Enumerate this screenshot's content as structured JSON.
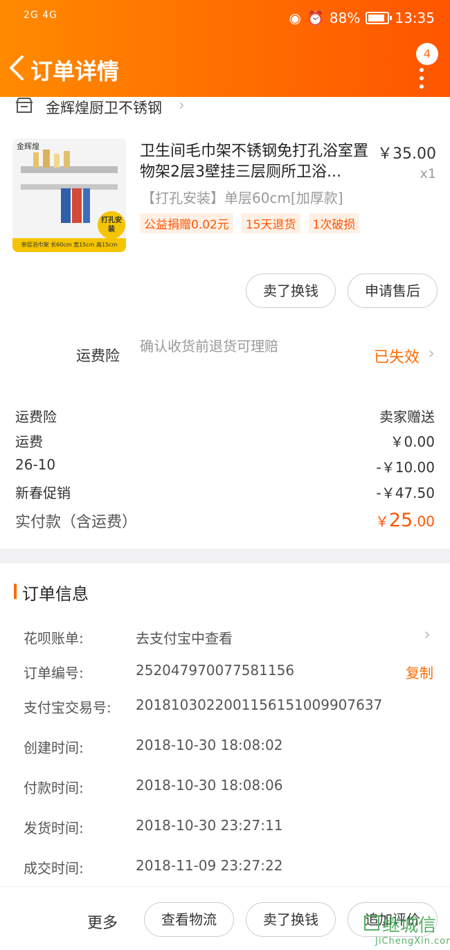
{
  "status_bar": {
    "signal": "2G 4G",
    "battery": "88%",
    "battery_level": 0.88,
    "time": "13:35"
  },
  "header": {
    "title": "订单详情",
    "badge_count": "4"
  },
  "shop": {
    "name": "金辉煌厨卫不锈钢"
  },
  "product": {
    "name": "卫生间毛巾架不锈钢免打孔浴室置物架2层3壁挂三层厕所卫浴...",
    "price": "￥35.00",
    "qty": "x1",
    "sku": "【打孔安装】单层60cm[加厚款]",
    "tags": [
      "公益捐赠0.02元",
      "15天退货",
      "1次破损"
    ],
    "image_brand": "金辉煌",
    "image_badge": "打孔安装",
    "image_caption": "单层浴巾架 长60cm 宽15cm 高15cm"
  },
  "actions": {
    "sell": "卖了换钱",
    "after_sale": "申请售后"
  },
  "insurance": {
    "label": "运费险",
    "desc": "确认收货前退货可理赔",
    "status": "已失效"
  },
  "fees": [
    {
      "label": "运费险",
      "value": "卖家赠送"
    },
    {
      "label": "运费",
      "value": "￥0.00"
    },
    {
      "label": "26-10",
      "value": "-￥10.00"
    },
    {
      "label": "新春促销",
      "value": "-￥47.50"
    }
  ],
  "total": {
    "label": "实付款（含运费）",
    "currency": "￥",
    "int": "25",
    "dec": ".00"
  },
  "order_info": {
    "title": "订单信息",
    "rows": [
      {
        "label": "花呗账单:",
        "value": "去支付宝中查看"
      },
      {
        "label": "订单编号:",
        "value": "252047970077581156",
        "action": "复制"
      },
      {
        "label": "支付宝交易号:",
        "value": "2018103022001156151009907637"
      },
      {
        "label": "创建时间:",
        "value": "2018-10-30 18:08:02"
      },
      {
        "label": "付款时间:",
        "value": "2018-10-30 18:08:06"
      },
      {
        "label": "发货时间:",
        "value": "2018-10-30 23:27:11"
      },
      {
        "label": "成交时间:",
        "value": "2018-11-09 23:27:22"
      }
    ]
  },
  "bottom_bar": {
    "more": "更多",
    "logistics": "查看物流",
    "sell": "卖了换钱",
    "review": "追加评价"
  },
  "watermark": {
    "text": "继城信",
    "sub": "JiChengXin.com"
  },
  "colors": {
    "accent": "#ff6a00",
    "price": "#ff5500"
  }
}
